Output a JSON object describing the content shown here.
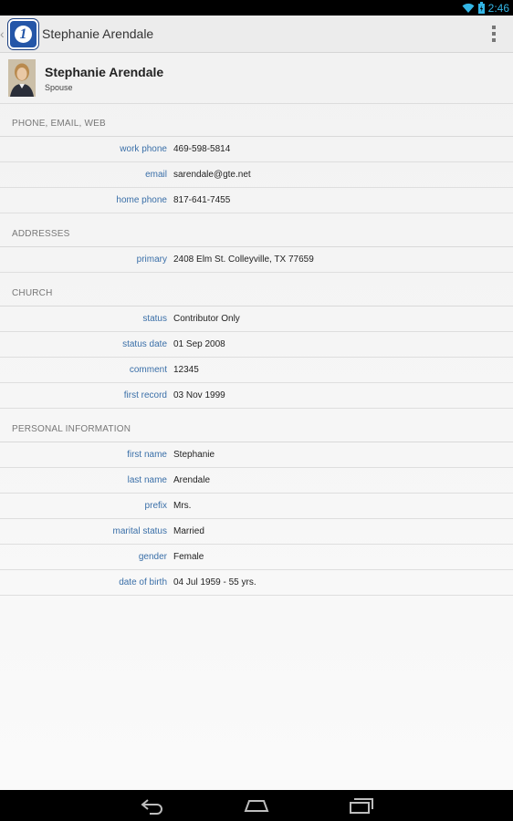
{
  "status_bar": {
    "time": "2:46"
  },
  "action_bar": {
    "title": "Stephanie Arendale"
  },
  "profile": {
    "name": "Stephanie Arendale",
    "relation": "Spouse"
  },
  "sections": {
    "phone": {
      "title": "PHONE, EMAIL, WEB",
      "rows": [
        {
          "label": "work phone",
          "value": "469-598-5814"
        },
        {
          "label": "email",
          "value": "sarendale@gte.net"
        },
        {
          "label": "home phone",
          "value": "817-641-7455"
        }
      ]
    },
    "addresses": {
      "title": "ADDRESSES",
      "rows": [
        {
          "label": "primary",
          "value": "2408 Elm St. Colleyville, TX 77659"
        }
      ]
    },
    "church": {
      "title": "CHURCH",
      "rows": [
        {
          "label": "status",
          "value": "Contributor Only"
        },
        {
          "label": "status date",
          "value": "01 Sep 2008"
        },
        {
          "label": "comment",
          "value": "12345"
        },
        {
          "label": "first record",
          "value": "03 Nov 1999"
        }
      ]
    },
    "personal": {
      "title": "PERSONAL INFORMATION",
      "rows": [
        {
          "label": "first name",
          "value": "Stephanie"
        },
        {
          "label": "last name",
          "value": "Arendale"
        },
        {
          "label": "prefix",
          "value": "Mrs."
        },
        {
          "label": "marital status",
          "value": "Married"
        },
        {
          "label": "gender",
          "value": "Female"
        },
        {
          "label": "date of birth",
          "value": "04 Jul 1959 - 55 yrs."
        }
      ]
    }
  },
  "colors": {
    "accent": "#33b5e5",
    "label": "#3a6fa8",
    "logo": "#2456a8"
  },
  "icons": [
    "wifi-icon",
    "battery-icon",
    "app-logo-icon",
    "overflow-menu-icon",
    "back-icon",
    "home-icon",
    "recents-icon"
  ]
}
